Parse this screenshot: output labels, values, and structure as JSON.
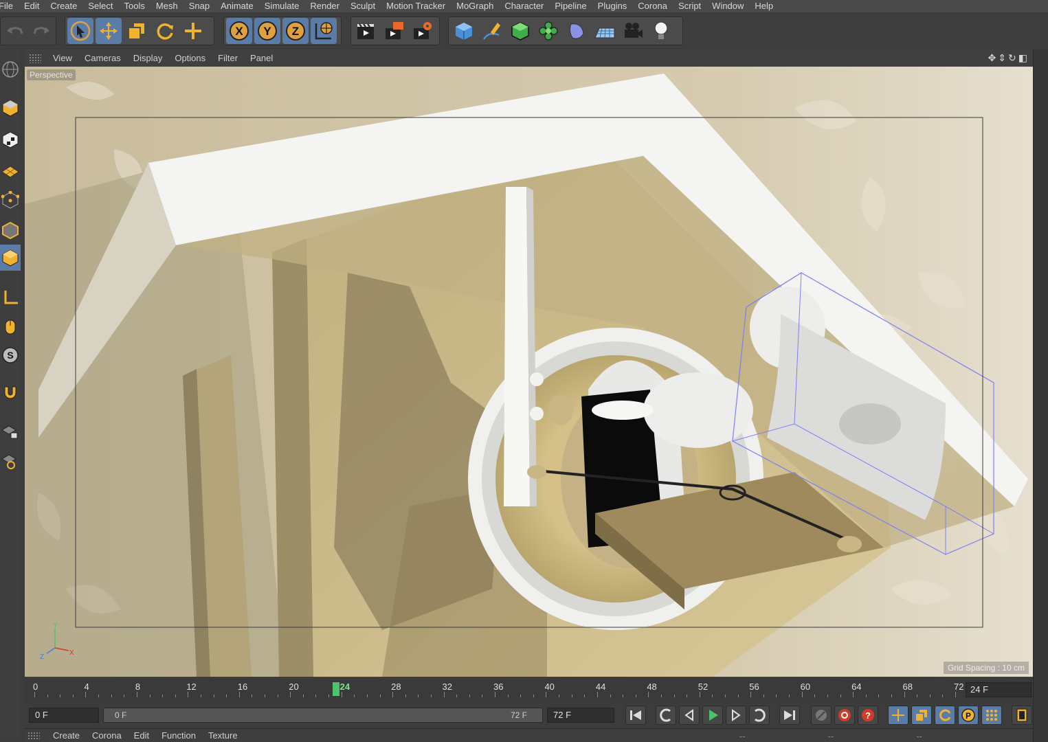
{
  "menubar": {
    "items": [
      "File",
      "Edit",
      "Create",
      "Select",
      "Tools",
      "Mesh",
      "Snap",
      "Animate",
      "Simulate",
      "Render",
      "Sculpt",
      "Motion Tracker",
      "MoGraph",
      "Character",
      "Pipeline",
      "Plugins",
      "Corona",
      "Script",
      "Window",
      "Help"
    ]
  },
  "viewport": {
    "menu": [
      "View",
      "Cameras",
      "Display",
      "Options",
      "Filter",
      "Panel"
    ],
    "label": "Perspective",
    "grid_spacing": "Grid Spacing : 10 cm",
    "axis": {
      "x": "X",
      "y": "Y",
      "z": "Z"
    }
  },
  "timeline": {
    "ticks": [
      "0",
      "4",
      "8",
      "12",
      "16",
      "20",
      "24",
      "28",
      "32",
      "36",
      "40",
      "44",
      "48",
      "52",
      "56",
      "60",
      "64",
      "68",
      "72"
    ],
    "current_marker": "24",
    "current_frame_value": "24 F",
    "max_frames": 72
  },
  "transport": {
    "start_field": "0 F",
    "range_start": "0 F",
    "range_end": "72 F",
    "end_field": "72 F"
  },
  "material_bar": {
    "menu": [
      "Create",
      "Corona",
      "Edit",
      "Function",
      "Texture"
    ],
    "right_placeholders": [
      "--",
      "--",
      "--"
    ]
  },
  "colors": {
    "accent": "#5c7ca8",
    "play_green": "#4bc46c",
    "record_red": "#d23a2a"
  }
}
